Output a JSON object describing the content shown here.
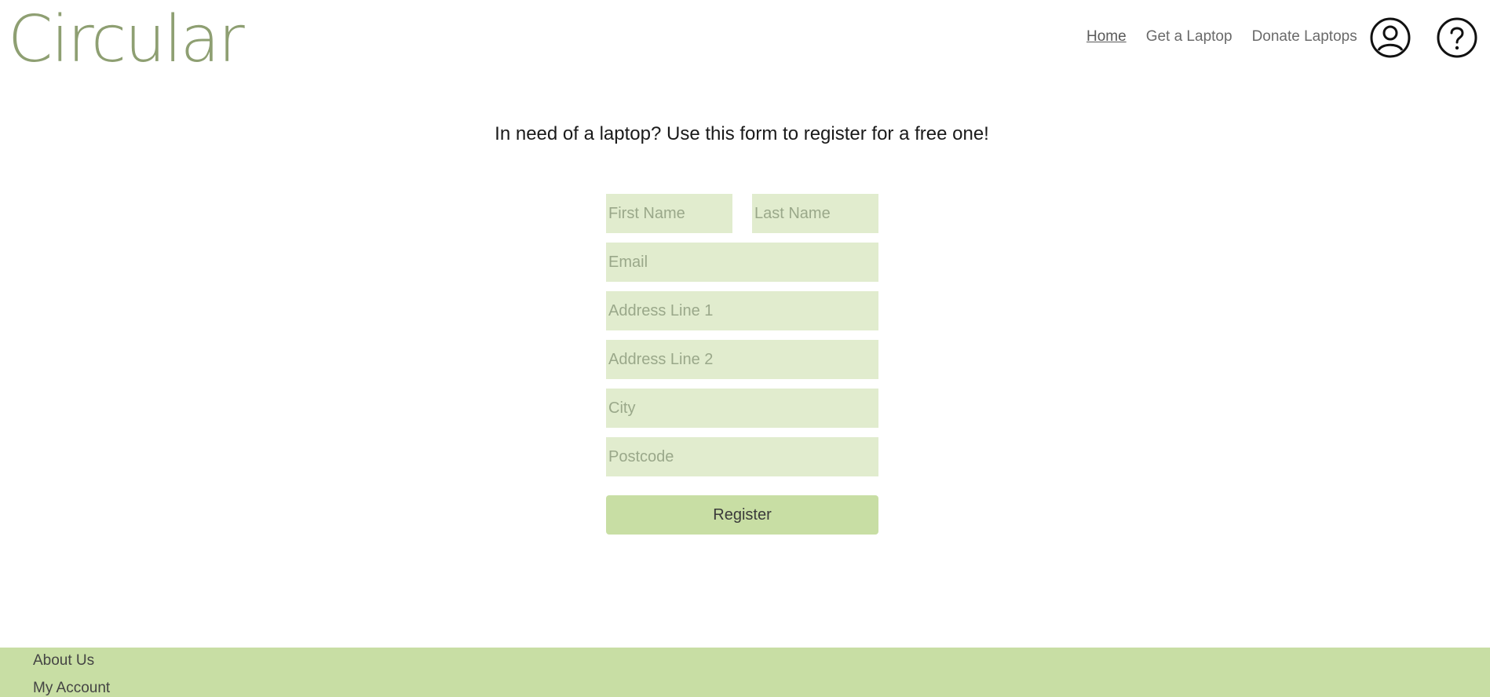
{
  "header": {
    "logo": "Circular",
    "nav": {
      "home": "Home",
      "get_laptop": "Get a Laptop",
      "donate": "Donate Laptops"
    },
    "icons": {
      "account": "account-icon",
      "help": "help-icon"
    }
  },
  "main": {
    "intro": "In need of a laptop? Use this form to register for a free one!",
    "form": {
      "first_name_placeholder": "First Name",
      "last_name_placeholder": "Last Name",
      "email_placeholder": "Email",
      "address1_placeholder": "Address Line 1",
      "address2_placeholder": "Address Line 2",
      "city_placeholder": "City",
      "postcode_placeholder": "Postcode",
      "register_label": "Register"
    }
  },
  "footer": {
    "about": "About Us",
    "account": "My Account"
  },
  "colors": {
    "brand": "#8e9f72",
    "field_bg": "#e1ecce",
    "accent": "#c8dea4"
  }
}
